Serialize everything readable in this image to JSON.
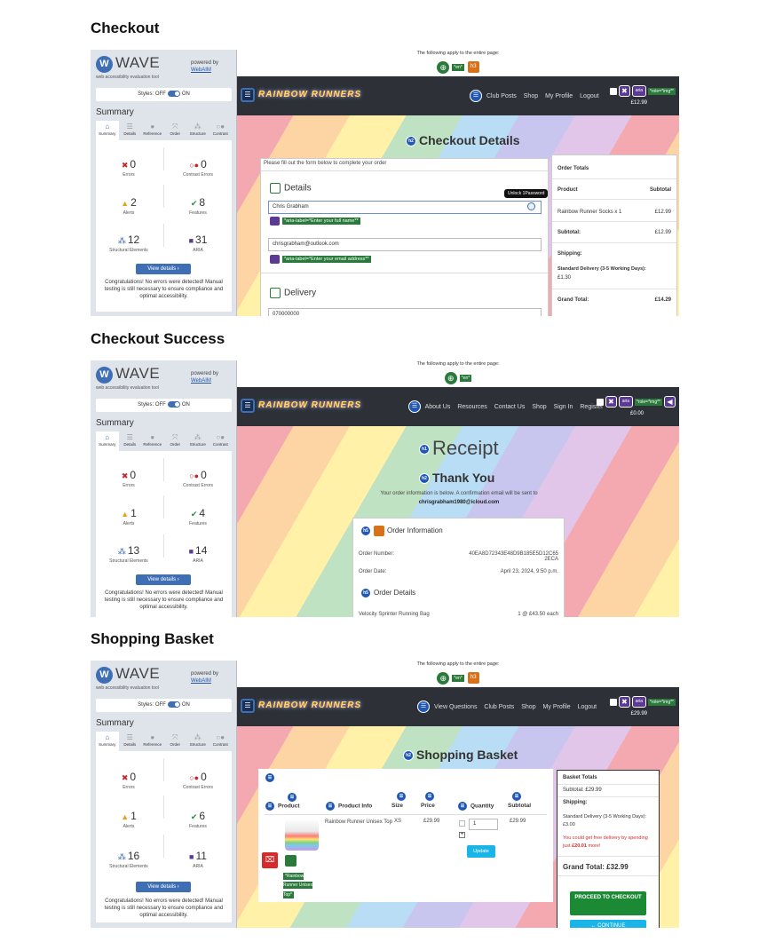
{
  "sections": {
    "checkout": "Checkout",
    "success": "Checkout Success",
    "basket": "Shopping Basket"
  },
  "wave": {
    "title": "WAVE",
    "subtitle": "web accessibility evaluation tool",
    "powered_by": "powered by",
    "webaim": "WebAIM",
    "styles": "Styles:",
    "off": "OFF",
    "on": "ON",
    "summary": "Summary",
    "tabs": [
      "Summary",
      "Details",
      "Reference",
      "Order",
      "Structure",
      "Contrast"
    ],
    "labels": {
      "errors": "Errors",
      "contrast": "Contrast Errors",
      "alerts": "Alerts",
      "features": "Features",
      "structural": "Structural Elements",
      "aria": "ARIA"
    },
    "view_details": "View details ›",
    "congrats": "Congratulations! No errors were detected! Manual testing is still necessary to ensure compliance and optimal accessibility."
  },
  "panels": [
    {
      "errors": "0",
      "contrast": "0",
      "alerts": "2",
      "features": "8",
      "structural": "12",
      "aria": "31"
    },
    {
      "errors": "0",
      "contrast": "0",
      "alerts": "1",
      "features": "4",
      "structural": "13",
      "aria": "14"
    },
    {
      "errors": "0",
      "contrast": "0",
      "alerts": "1",
      "features": "6",
      "structural": "16",
      "aria": "11"
    }
  ],
  "site": {
    "applies": "The following apply to the entire page:",
    "lang_tag": "*en*",
    "h3": "h3",
    "brand": "RAINBOW RUNNERS",
    "role_img": "*role=*img**",
    "aria": "aria"
  },
  "checkout": {
    "nav": [
      "Club Posts",
      "Shop",
      "My Profile",
      "Logout"
    ],
    "cart_total": "£12.99",
    "heading": "Checkout Details",
    "heading_level": "h2",
    "intro": "Please fill out the form below to complete your order",
    "details": "Details",
    "name_value": "Chris Grabham",
    "tooltip": "Unlock 1Password",
    "aria_name": "*aria-label=*Enter your full name**",
    "email_value": "chrisgrabham@outlook.com",
    "aria_email": "*aria-label=*Enter your email address**",
    "delivery": "Delivery",
    "phone_value": "070000000",
    "totals": {
      "title": "Order Totals",
      "product_h": "Product",
      "subtotal_h": "Subtotal",
      "item": "Rainbow Runner Socks x 1",
      "item_price": "£12.99",
      "subtotal_label": "Subtotal:",
      "subtotal": "£12.99",
      "shipping": "Shipping:",
      "delivery_name": "Standard Delivery (3-5 Working Days):",
      "delivery_price": "£1.30",
      "grand_label": "Grand Total:",
      "grand": "£14.29"
    }
  },
  "success": {
    "nav": [
      "About Us",
      "Resources",
      "Contact Us",
      "Shop",
      "Sign In",
      "Register"
    ],
    "cart_total": "£0.00",
    "h1": "h1",
    "receipt": "Receipt",
    "h2": "h2",
    "thank_you": "Thank You",
    "message": "Your order information is below. A confirmation email will be sent to",
    "email": "chrisgrabham1980@icloud.com",
    "h5": "h5",
    "order_info": "Order Information",
    "order_number_label": "Order Number:",
    "order_number": "40EA8D72343E48D9B185E5D12C65 2ECA",
    "order_date_label": "Order Date:",
    "order_date": "April 23, 2024, 9:50 p.m.",
    "order_details": "Order Details",
    "item": "Velocity Sprinter Running Bag",
    "item_qty": "1 @ £43.50 each"
  },
  "basket": {
    "nav": [
      "View Questions",
      "Club Posts",
      "Shop",
      "My Profile",
      "Logout"
    ],
    "cart_total": "£29.99",
    "heading": "Shopping Basket",
    "h2": "h2",
    "cols": [
      "Product",
      "Product Info",
      "Size",
      "Price",
      "Quantity",
      "Subtotal"
    ],
    "product_name": "Rainbow Runner Unisex Top",
    "size": "XS",
    "price": "£29.99",
    "qty": "1",
    "subtotal": "£29.99",
    "update": "Update",
    "alt_text": "*Rainbow Runner Unisex Top*",
    "totals": {
      "title": "Basket Totals",
      "subtotal": "Subtotal: £29.99",
      "shipping": "Shipping:",
      "delivery": "Standard Delivery (3-5 Working Days): £3.00",
      "free_pre": "You could get free delivery by spending just",
      "free_amount": "£20.01",
      "free_post": "more!",
      "grand": "Grand Total: £32.99",
      "proceed": "PROCEED TO CHECKOUT",
      "continue": "← CONTINUE"
    }
  },
  "colors": {
    "wave_blue": "#3e6fb5",
    "error_red": "#c4282c",
    "alert_orange": "#e8a21a",
    "feature_green": "#2f8a3a",
    "aria_purple": "#5b3a94",
    "navbar": "#2d3137"
  }
}
